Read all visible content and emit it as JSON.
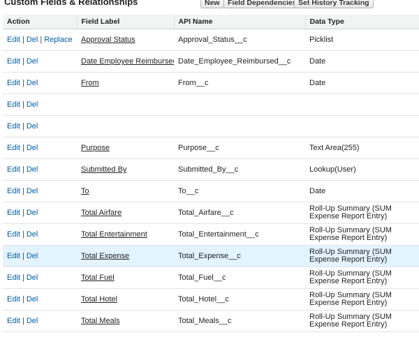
{
  "section": {
    "title": "Custom Fields & Relationships",
    "buttons": {
      "new": "New",
      "field_dependencies": "Field Dependencies",
      "set_history_tracking": "Set History Tracking"
    }
  },
  "table": {
    "headers": {
      "action": "Action",
      "field_label": "Field Label",
      "api_name": "API Name",
      "data_type": "Data Type"
    },
    "action_labels": {
      "edit": "Edit",
      "del": "Del",
      "replace": "Replace",
      "separator": "|"
    },
    "rows": [
      {
        "label": "Approval Status",
        "api": "Approval_Status__c",
        "type": "Picklist",
        "replace": true
      },
      {
        "label": "Date Employee Reimbursed",
        "api": "Date_Employee_Reimbursed__c",
        "type": "Date"
      },
      {
        "label": "From",
        "api": "From__c",
        "type": "Date"
      },
      {
        "label": "",
        "api": "",
        "type": ""
      },
      {
        "label": "",
        "api": "",
        "type": ""
      },
      {
        "label": "Purpose",
        "api": "Purpose__c",
        "type": "Text Area(255)"
      },
      {
        "label": "Submitted By",
        "api": "Submitted_By__c",
        "type": "Lookup(User)"
      },
      {
        "label": "To",
        "api": "To__c",
        "type": "Date"
      },
      {
        "label": "Total Airfare",
        "api": "Total_Airfare__c",
        "type": "Roll-Up Summary (SUM Expense Report Entry)"
      },
      {
        "label": "Total Entertainment",
        "api": "Total_Entertainment__c",
        "type": "Roll-Up Summary (SUM Expense Report Entry)"
      },
      {
        "label": "Total Expense",
        "api": "Total_Expense__c",
        "type": "Roll-Up Summary (SUM Expense Report Entry)",
        "highlighted": true
      },
      {
        "label": "Total Fuel",
        "api": "Total_Fuel__c",
        "type": "Roll-Up Summary (SUM Expense Report Entry)"
      },
      {
        "label": "Total Hotel",
        "api": "Total_Hotel__c",
        "type": "Roll-Up Summary (SUM Expense Report Entry)"
      },
      {
        "label": "Total Meals",
        "api": "Total_Meals__c",
        "type": "Roll-Up Summary (SUM Expense Report Entry)"
      }
    ]
  },
  "colors": {
    "link": "#015ba7",
    "header_bg": "#f2f3f3",
    "highlight": "#e3f3ff"
  }
}
